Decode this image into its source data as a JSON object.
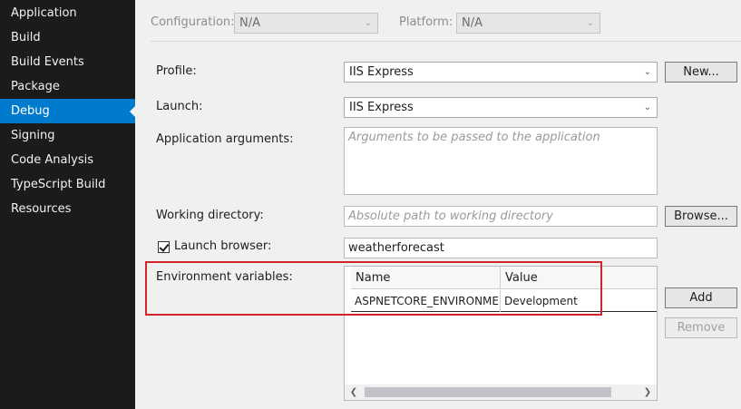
{
  "sidebar": {
    "items": [
      {
        "label": "Application"
      },
      {
        "label": "Build"
      },
      {
        "label": "Build Events"
      },
      {
        "label": "Package"
      },
      {
        "label": "Debug",
        "active": true
      },
      {
        "label": "Signing"
      },
      {
        "label": "Code Analysis"
      },
      {
        "label": "TypeScript Build"
      },
      {
        "label": "Resources"
      }
    ]
  },
  "config": {
    "configuration_label": "Configuration:",
    "configuration_value": "N/A",
    "platform_label": "Platform:",
    "platform_value": "N/A"
  },
  "debug": {
    "profile_label": "Profile:",
    "profile_value": "IIS Express",
    "new_button": "New...",
    "launch_label": "Launch:",
    "launch_value": "IIS Express",
    "app_args_label": "Application arguments:",
    "app_args_placeholder": "Arguments to be passed to the application",
    "workdir_label": "Working directory:",
    "workdir_placeholder": "Absolute path to working directory",
    "browse_button": "Browse...",
    "launch_browser_label": "Launch browser:",
    "launch_browser_checked": true,
    "launch_browser_value": "weatherforecast",
    "env_label": "Environment variables:",
    "env_columns": [
      "Name",
      "Value"
    ],
    "env_rows": [
      {
        "name": "ASPNETCORE_ENVIRONMENT",
        "value": "Development"
      }
    ],
    "add_button": "Add",
    "remove_button": "Remove"
  },
  "colors": {
    "sidebar_bg": "#1b1b1c",
    "active_item": "#007acc",
    "highlight_box": "#d0252b"
  }
}
